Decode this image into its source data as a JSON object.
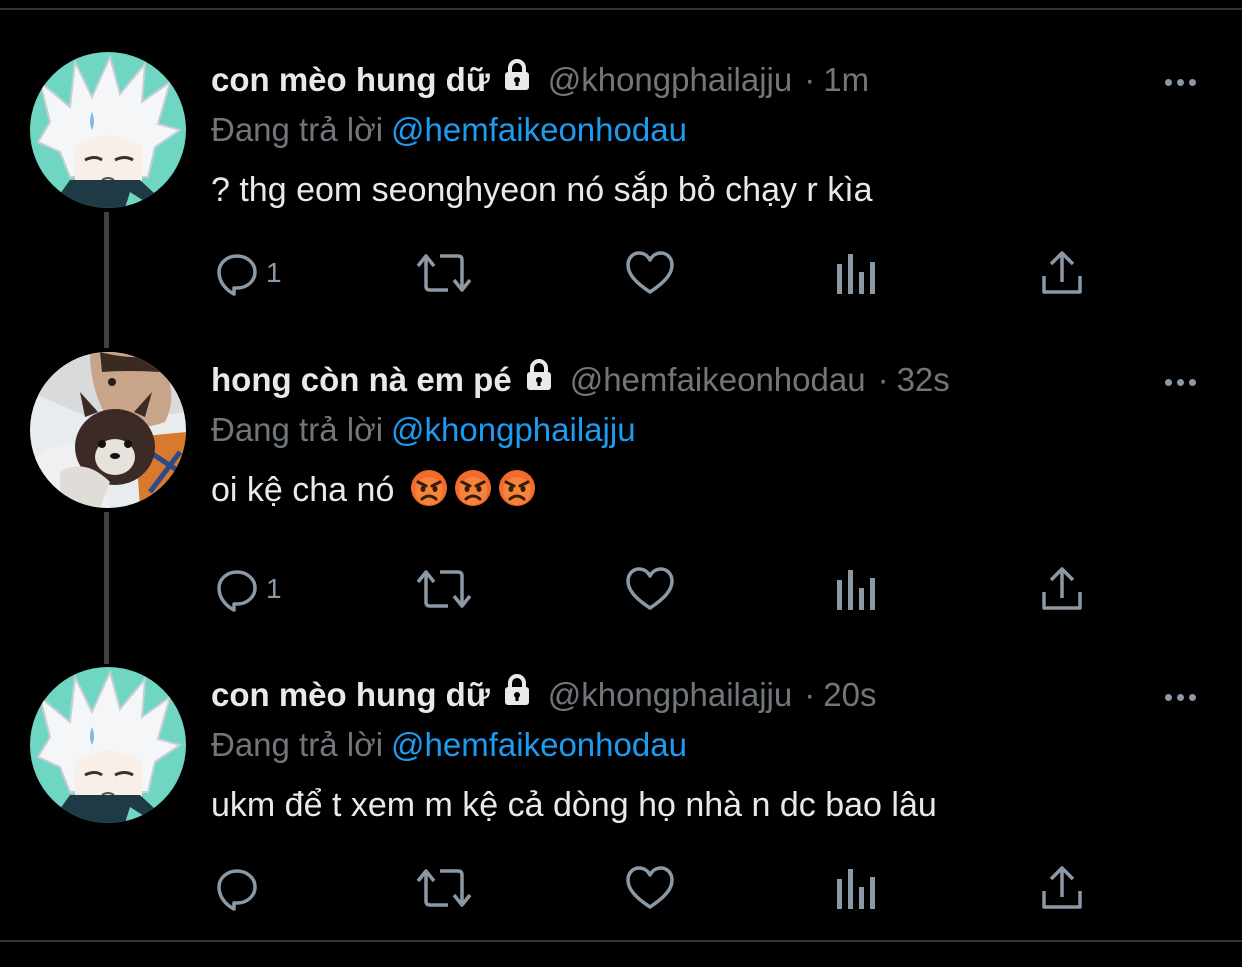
{
  "tweets": [
    {
      "display_name": "con mèo hung dữ",
      "handle": "@khongphailajju",
      "separator": "·",
      "time": "1m",
      "reply_label": "Đang trả lời",
      "reply_to": "@hemfaikeonhodau",
      "text": "? thg eom seonghyeon nó sắp bỏ chạy r kìa",
      "reply_count": "1",
      "avatar": "anime-boy-avatar"
    },
    {
      "display_name": "hong còn nà em pé",
      "handle": "@hemfaikeonhodau",
      "separator": "·",
      "time": "32s",
      "reply_label": "Đang trả lời",
      "reply_to": "@khongphailajju",
      "text": "oi kệ cha nó",
      "emoji": [
        "angry-face-emoji",
        "angry-face-emoji",
        "angry-face-emoji"
      ],
      "reply_count": "1",
      "avatar": "photo-dog-avatar"
    },
    {
      "display_name": "con mèo hung dữ",
      "handle": "@khongphailajju",
      "separator": "·",
      "time": "20s",
      "reply_label": "Đang trả lời",
      "reply_to": "@hemfaikeonhodau",
      "text": "ukm để t xem m kệ cả dòng họ nhà n dc bao lâu",
      "reply_count": "",
      "avatar": "anime-boy-avatar"
    }
  ],
  "icons": [
    "lock-icon",
    "more-icon",
    "reply-icon",
    "retweet-icon",
    "like-icon",
    "analytics-icon",
    "share-icon"
  ],
  "colors": {
    "background": "#000000",
    "text": "#e7e9ea",
    "secondary": "#71767b",
    "mention": "#1d9bf0",
    "icon": "#8b98a5"
  }
}
